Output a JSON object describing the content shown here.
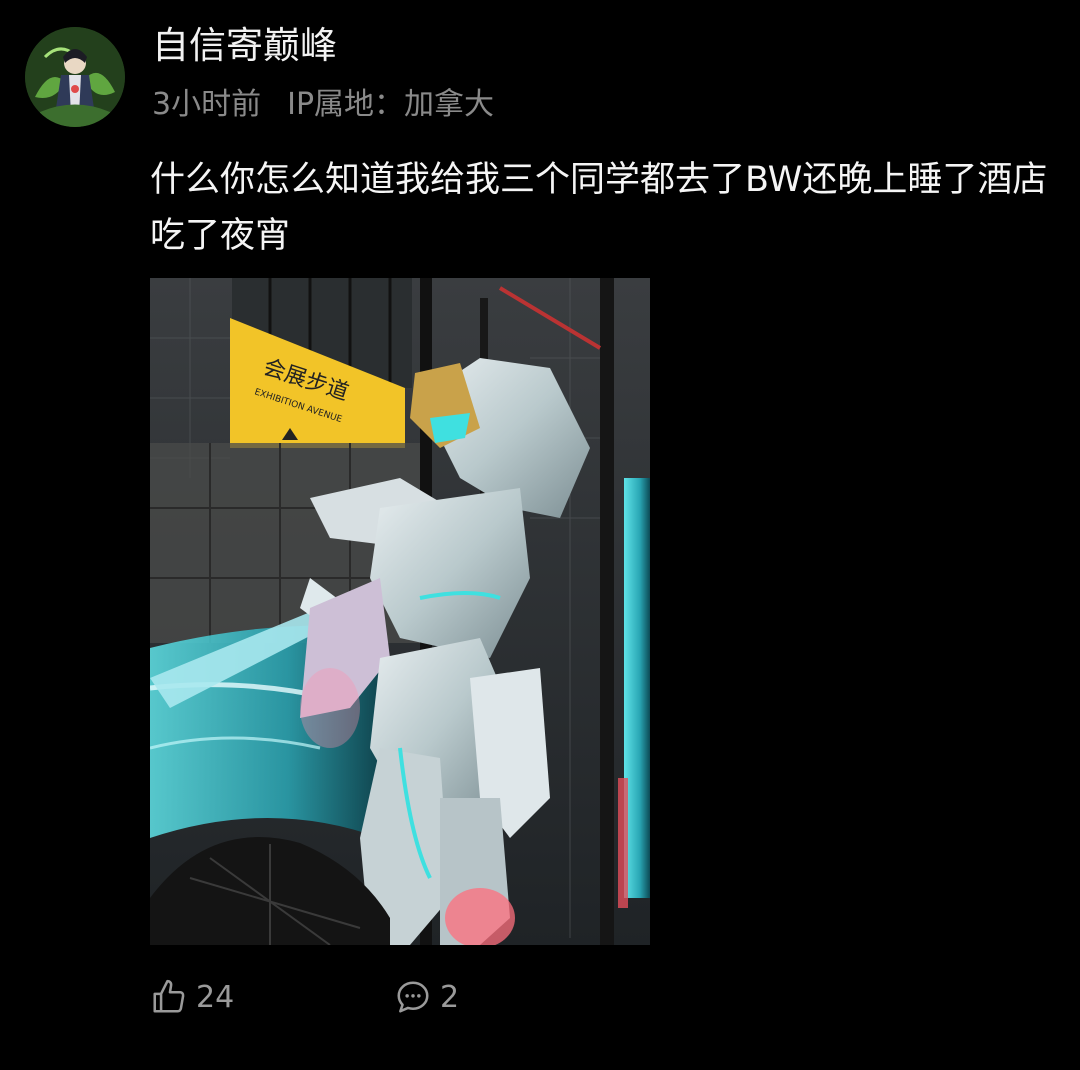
{
  "post": {
    "author": {
      "name": "自信寄巅峰",
      "avatar_icon": "avatar-image"
    },
    "time": "3小时前",
    "ip_location": "IP属地：加拿大",
    "text": "什么你怎么知道我给我三个同学都去了BW还晚上睡了酒店吃了夜宵",
    "image": {
      "sign_text_cn": "会展步道",
      "sign_text_en": "EXHIBITION AVENUE",
      "accent_color": "#39d6d6"
    }
  },
  "actions": {
    "like_icon": "thumbs-up-icon",
    "like_count": "24",
    "comment_icon": "comment-bubble-icon",
    "comment_count": "2"
  },
  "colors": {
    "background": "#000000",
    "primary_text": "#f5f5f5",
    "secondary_text": "#8a8a8a"
  }
}
